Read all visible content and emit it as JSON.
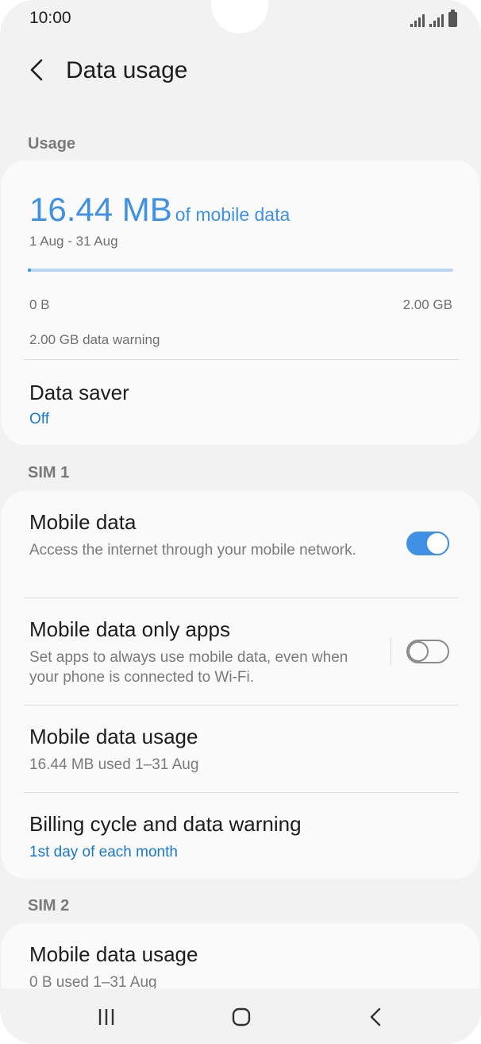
{
  "status_bar": {
    "time": "10:00",
    "signal_icon": "signal-icon",
    "battery_icon": "battery-icon"
  },
  "header": {
    "title": "Data usage",
    "back_icon": "back-arrow-icon"
  },
  "usage": {
    "section_label": "Usage",
    "amount": "16.44 MB",
    "amount_suffix": "of mobile data",
    "date_range": "1 Aug - 31 Aug",
    "progress_fraction": 0.008,
    "min_label": "0 B",
    "max_label": "2.00 GB",
    "warning_text": "2.00 GB data warning",
    "data_saver": {
      "title": "Data saver",
      "value": "Off"
    }
  },
  "sim1": {
    "section_label": "SIM 1",
    "mobile_data": {
      "title": "Mobile data",
      "subtitle": "Access the internet through your mobile network.",
      "enabled": true
    },
    "mobile_data_only_apps": {
      "title": "Mobile data only apps",
      "subtitle": "Set apps to always use mobile data, even when your phone is connected to Wi-Fi.",
      "enabled": false
    },
    "mobile_data_usage": {
      "title": "Mobile data usage",
      "subtitle": "16.44 MB used 1–31 Aug"
    },
    "billing": {
      "title": "Billing cycle and data warning",
      "subtitle": "1st day of each month"
    }
  },
  "sim2": {
    "section_label": "SIM 2",
    "mobile_data_usage": {
      "title": "Mobile data usage",
      "subtitle": "0 B used 1–31 Aug"
    }
  },
  "nav_bar": {
    "recents_icon": "recents-icon",
    "home_icon": "home-icon",
    "back_icon": "back-icon"
  },
  "colors": {
    "accent": "#3e91e4",
    "link": "#1b78cf",
    "background": "#f2f2f2",
    "card": "#fafafa"
  }
}
